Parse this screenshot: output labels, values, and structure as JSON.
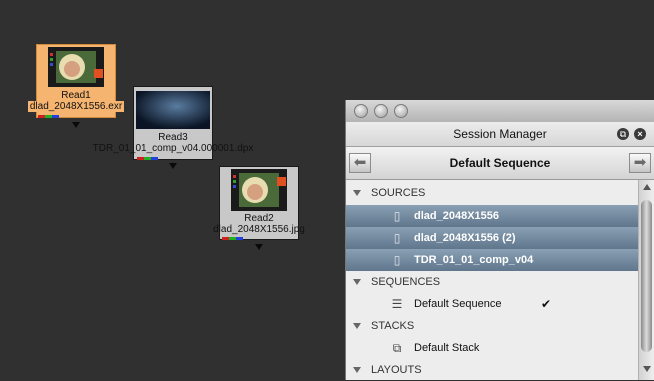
{
  "nodes": {
    "read1": {
      "name": "Read1",
      "file": "dlad_2048X1556.exr"
    },
    "read3": {
      "name": "Read3",
      "file": "TDR_01_01_comp_v04.000001.dpx"
    },
    "read2": {
      "name": "Read2",
      "file": "dlad_2048X1556.jpg"
    }
  },
  "session_manager": {
    "title": "Session Manager",
    "sequence_title": "Default Sequence",
    "sections": {
      "sources": "SOURCES",
      "sequences": "SEQUENCES",
      "stacks": "STACKS",
      "layouts": "LAYOUTS"
    },
    "sources": [
      "dlad_2048X1556",
      "dlad_2048X1556 (2)",
      "TDR_01_01_comp_v04"
    ],
    "sequences": [
      {
        "label": "Default Sequence",
        "check": "✔"
      }
    ],
    "stacks": [
      {
        "label": "Default Stack"
      }
    ]
  },
  "colors": {
    "background": "#303030",
    "selected_node": "#f5b470",
    "selected_row": "#6f8599"
  },
  "icons": [
    "back-arrow-icon",
    "forward-arrow-icon",
    "file-icon",
    "sequence-icon",
    "stack-icon",
    "checkmark-icon"
  ]
}
